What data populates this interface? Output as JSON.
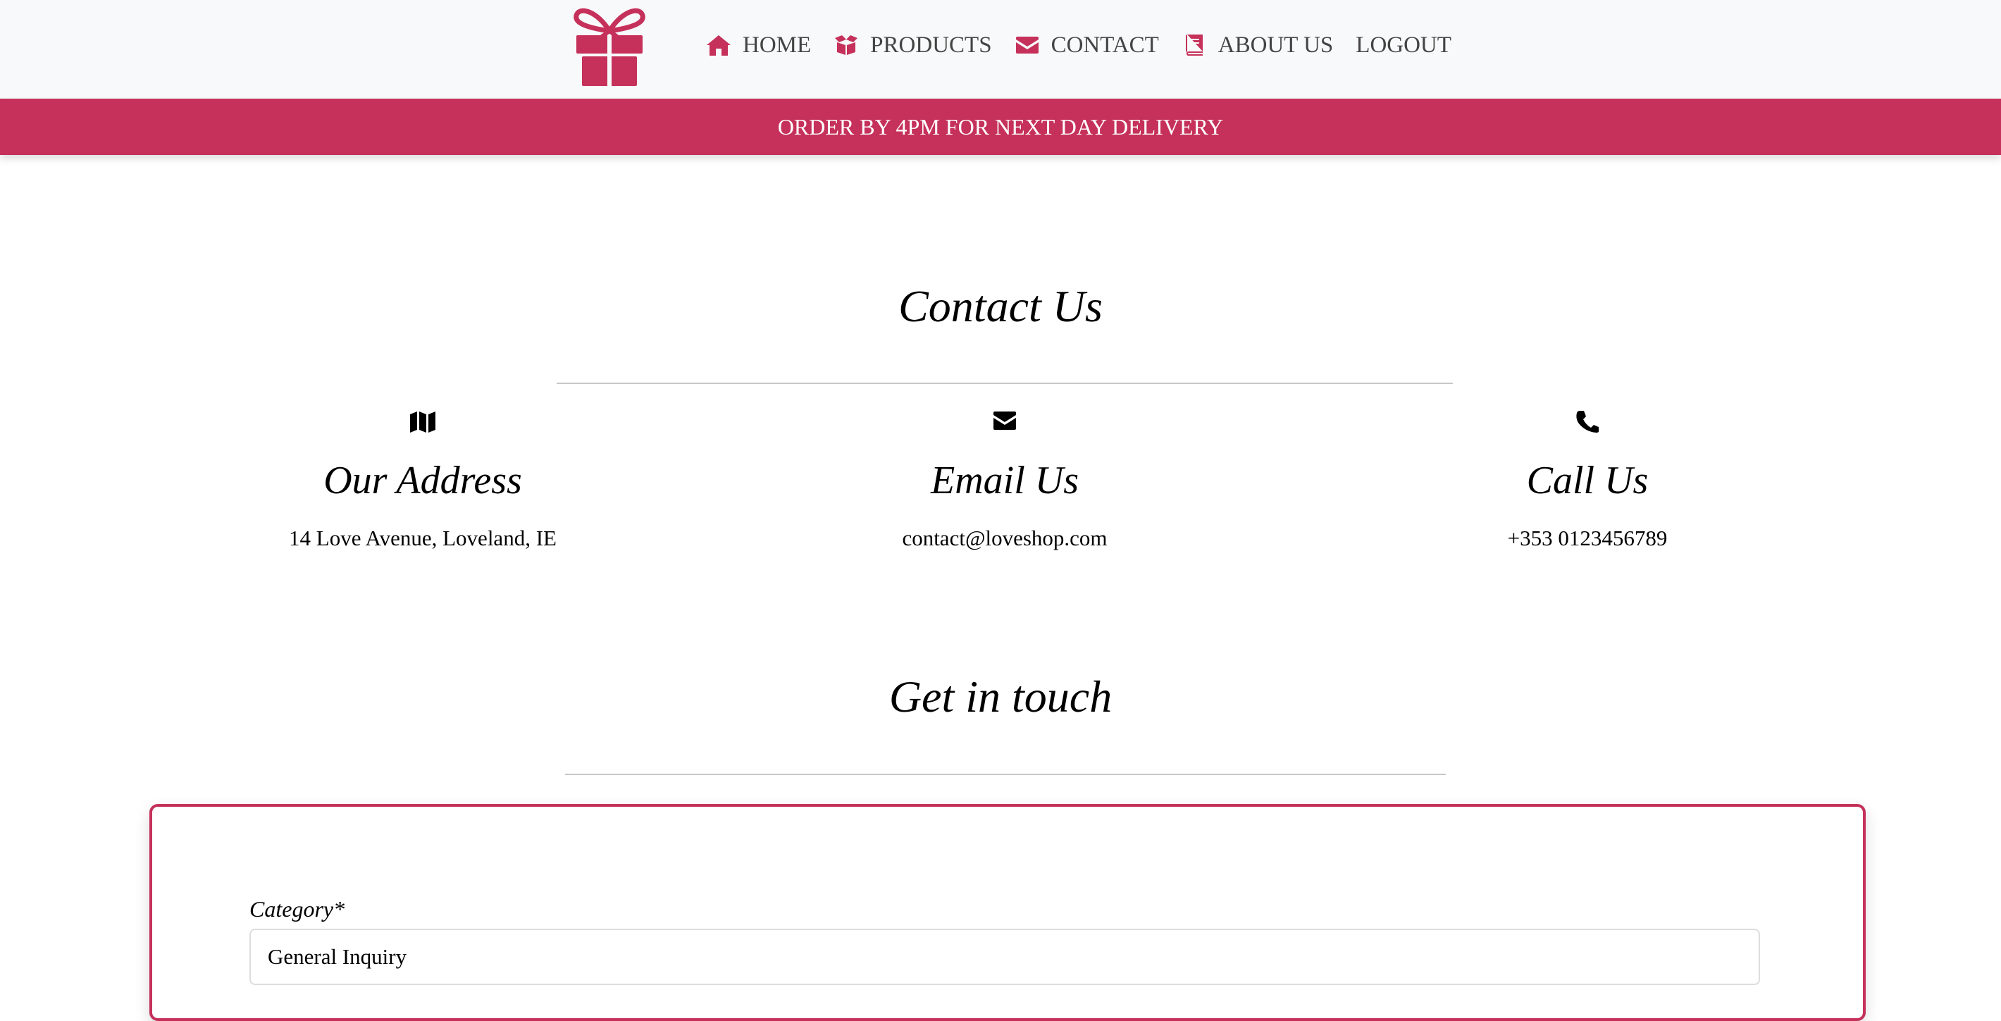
{
  "brand": {
    "accent": "#c5315a",
    "logo_icon": "gift-icon"
  },
  "nav": {
    "items": [
      {
        "label": "HOME",
        "icon": "home-icon"
      },
      {
        "label": "PRODUCTS",
        "icon": "box-icon"
      },
      {
        "label": "CONTACT",
        "icon": "envelope-icon"
      },
      {
        "label": "ABOUT US",
        "icon": "book-icon"
      },
      {
        "label": "LOGOUT",
        "icon": ""
      }
    ]
  },
  "banner": {
    "text": "ORDER BY 4PM FOR NEXT DAY DELIVERY"
  },
  "contact": {
    "title": "Contact Us",
    "columns": [
      {
        "icon": "map-icon",
        "title": "Our Address",
        "text": "14 Love Avenue, Loveland, IE"
      },
      {
        "icon": "envelope-icon",
        "title": "Email Us",
        "text": "contact@loveshop.com"
      },
      {
        "icon": "phone-icon",
        "title": "Call Us",
        "text": "+353 0123456789"
      }
    ]
  },
  "touch": {
    "title": "Get in touch",
    "form": {
      "category_label": "Category*",
      "category_value": "General Inquiry"
    }
  }
}
